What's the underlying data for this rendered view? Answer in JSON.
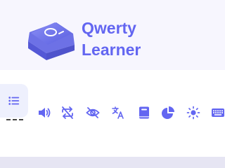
{
  "app": {
    "name_line1": "Qwerty",
    "name_line2": "Learner"
  },
  "colors": {
    "accent": "#6366f1",
    "header_bg": "#f7f6fe",
    "bottom_band": "#e6e5f3"
  },
  "toolbar": {
    "items": [
      {
        "icon": "list-icon"
      },
      {
        "icon": "volume-icon"
      },
      {
        "icon": "repeat-off-icon"
      },
      {
        "icon": "eye-off-icon"
      },
      {
        "icon": "translate-icon"
      },
      {
        "icon": "dictionary-book-icon"
      },
      {
        "icon": "pie-chart-icon"
      },
      {
        "icon": "sun-icon"
      },
      {
        "icon": "keyboard-icon"
      }
    ]
  }
}
